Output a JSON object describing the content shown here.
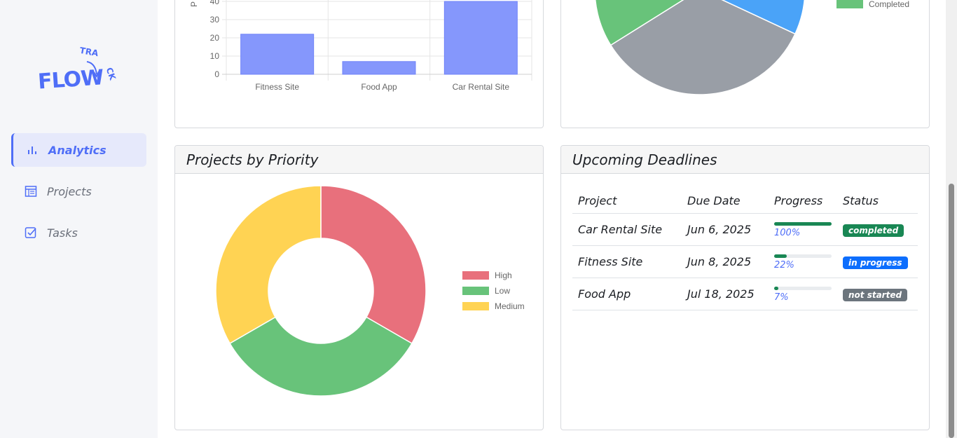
{
  "logo": {
    "word_flow": "FLOW",
    "word_track": "TRACK"
  },
  "sidebar": {
    "items": [
      {
        "label": "Analytics",
        "icon": "bar-chart-icon",
        "active": true
      },
      {
        "label": "Projects",
        "icon": "table-icon",
        "active": false
      },
      {
        "label": "Tasks",
        "icon": "checkbox-icon",
        "active": false
      }
    ]
  },
  "cards": {
    "priority_title": "Projects by Priority",
    "deadlines_title": "Upcoming Deadlines"
  },
  "colors": {
    "accent": "#4f6ef7",
    "bar": "#8597fc",
    "high": "#e8707c",
    "low": "#68c37a",
    "medium": "#ffd353",
    "status_blue": "#4aa3f8",
    "status_gray": "#999ea6",
    "completed_badge": "#198754",
    "in_progress_badge": "#0d6efd",
    "not_started_badge": "#6c757d"
  },
  "chart_data": [
    {
      "type": "bar",
      "categories": [
        "Fitness Site",
        "Food App",
        "Car Rental Site"
      ],
      "values": [
        22,
        7,
        40
      ],
      "ylabel": "P",
      "yticks": [
        0,
        10,
        20,
        30,
        40
      ],
      "grid": true
    },
    {
      "type": "pie",
      "labels": [
        "Completed",
        "",
        ""
      ],
      "values": [
        0.18,
        0.32,
        0.5
      ],
      "legend_visible": [
        "Completed"
      ],
      "legend_position": "right"
    },
    {
      "type": "pie",
      "donut": true,
      "labels": [
        "High",
        "Low",
        "Medium"
      ],
      "values": [
        1,
        1,
        1
      ],
      "legend_position": "right"
    }
  ],
  "deadlines": {
    "headers": [
      "Project",
      "Due Date",
      "Progress",
      "Status"
    ],
    "rows": [
      {
        "project": "Car Rental Site",
        "due": "Jun 6, 2025",
        "progress": 100,
        "progress_text": "100%",
        "status": "completed",
        "status_color": "#198754"
      },
      {
        "project": "Fitness Site",
        "due": "Jun 8, 2025",
        "progress": 22,
        "progress_text": "22%",
        "status": "in progress",
        "status_color": "#0d6efd"
      },
      {
        "project": "Food App",
        "due": "Jul 18, 2025",
        "progress": 7,
        "progress_text": "7%",
        "status": "not started",
        "status_color": "#6c757d"
      }
    ]
  }
}
